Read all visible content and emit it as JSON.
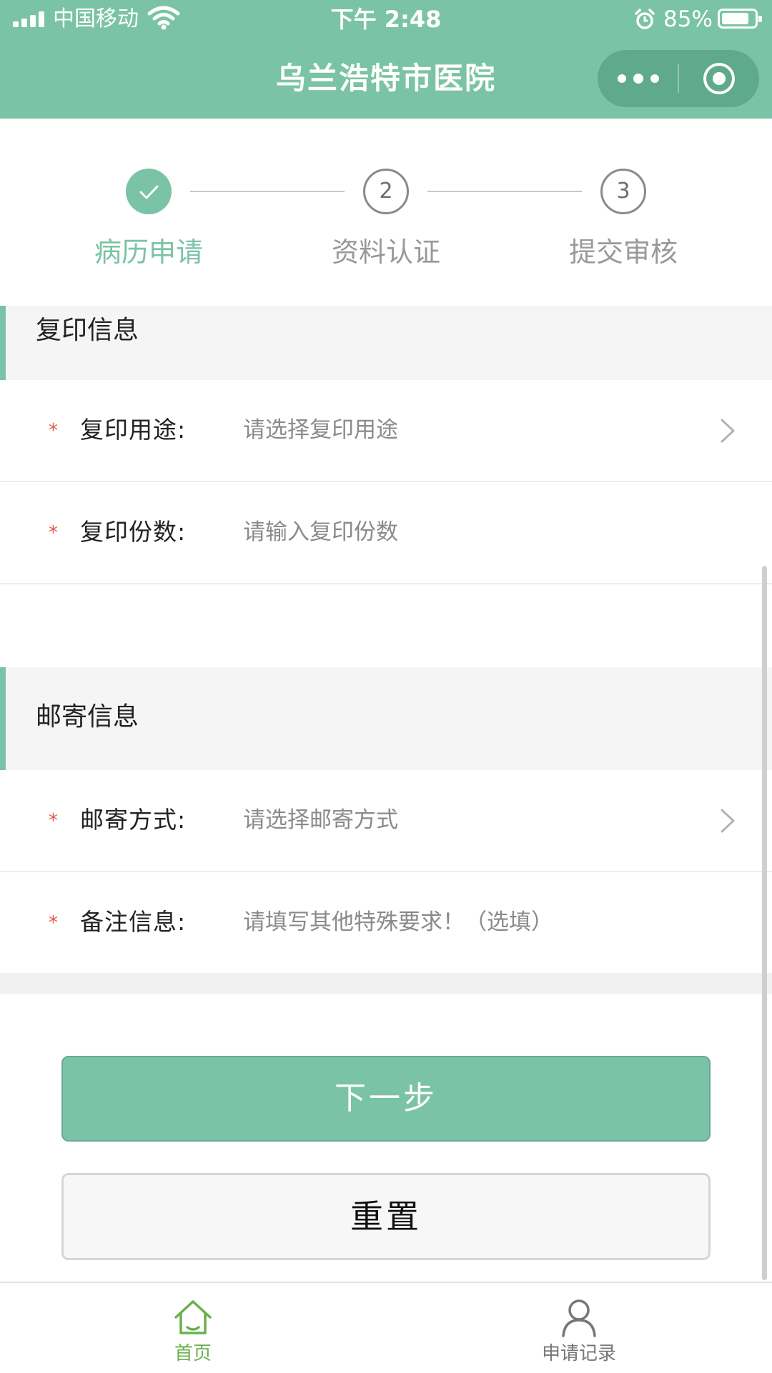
{
  "status_bar": {
    "carrier": "中国移动",
    "time": "下午 2:48",
    "battery_percent": "85%",
    "battery_level": 0.85
  },
  "nav": {
    "title": "乌兰浩特市医院"
  },
  "stepper": {
    "steps": [
      {
        "number": "1",
        "label": "病历申请",
        "state": "done"
      },
      {
        "number": "2",
        "label": "资料认证",
        "state": "todo"
      },
      {
        "number": "3",
        "label": "提交审核",
        "state": "todo"
      }
    ]
  },
  "copy_section": {
    "title": "复印信息",
    "fields": [
      {
        "label": "复印用途:",
        "placeholder": "请选择复印用途",
        "has_arrow": true
      },
      {
        "label": "复印份数:",
        "placeholder": "请输入复印份数",
        "has_arrow": false
      }
    ]
  },
  "mail_section": {
    "title": "邮寄信息",
    "fields": [
      {
        "label": "邮寄方式:",
        "placeholder": "请选择邮寄方式",
        "has_arrow": true
      },
      {
        "label": "备注信息:",
        "placeholder": "请填写其他特殊要求！（选填）",
        "has_arrow": false
      }
    ]
  },
  "required_mark": "*",
  "buttons": {
    "next": "下一步",
    "reset": "重置"
  },
  "tabbar": {
    "items": [
      {
        "label": "首页",
        "icon": "home-icon",
        "active": true
      },
      {
        "label": "申请记录",
        "icon": "user-icon",
        "active": false
      }
    ]
  },
  "colors": {
    "accent": "#7bc3a6",
    "required": "#e05a4e",
    "tab_active": "#6ab04c"
  }
}
